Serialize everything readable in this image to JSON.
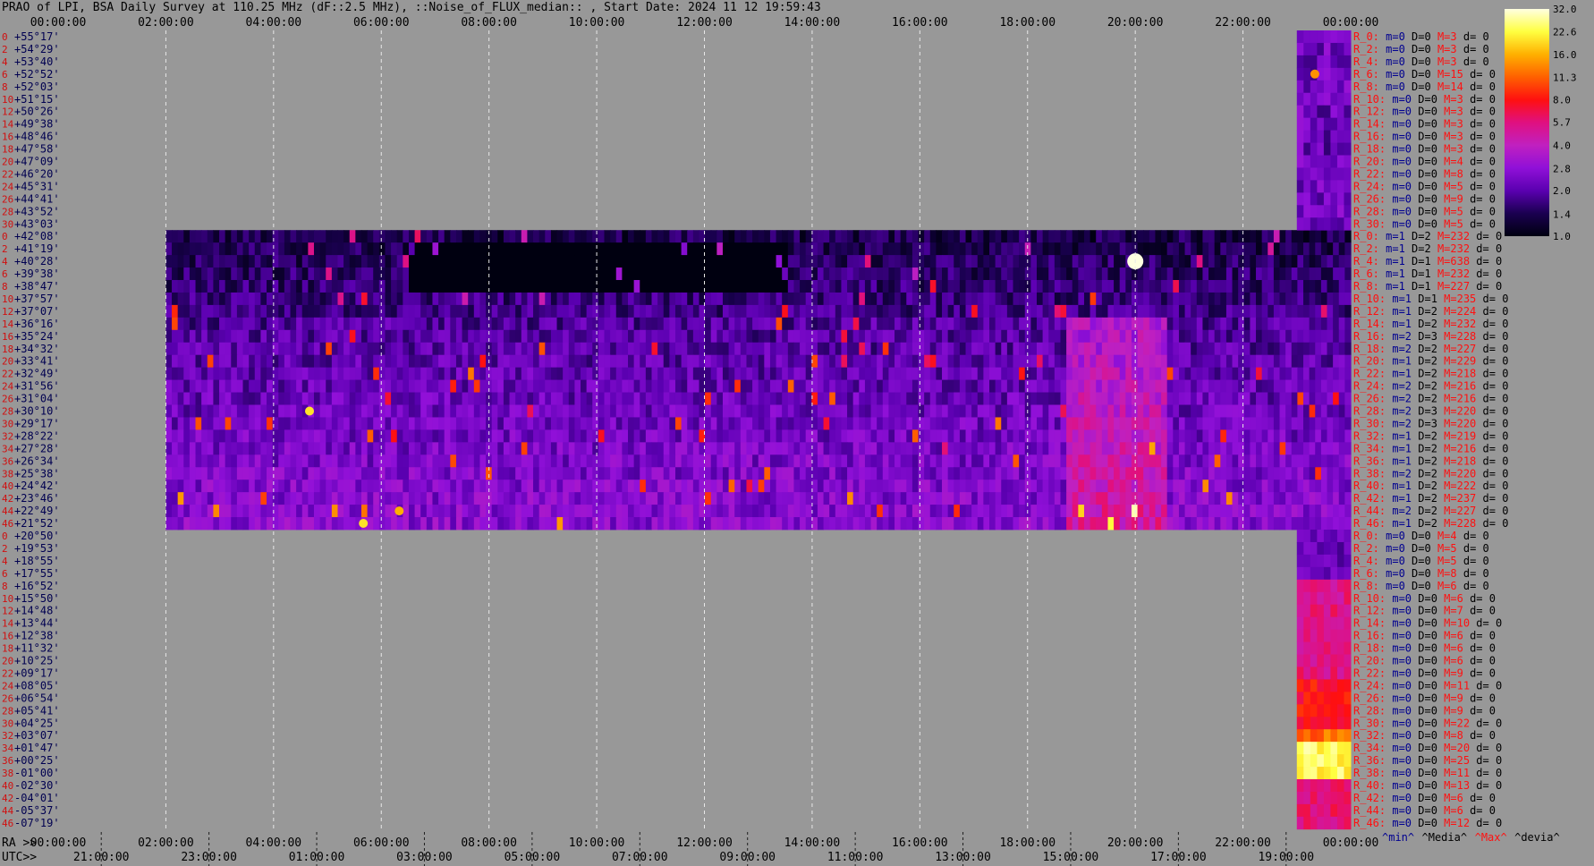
{
  "title": "PRAO of LPI, BSA Daily Survey at 110.25 MHz (dF::2.5 MHz), ::Noise_of_FLUX_median:: , Start Date: 2024 11 12 19:59:43",
  "top_time_labels": [
    "00:00:00",
    "02:00:00",
    "04:00:00",
    "06:00:00",
    "08:00:00",
    "10:00:00",
    "12:00:00",
    "14:00:00",
    "16:00:00",
    "18:00:00",
    "20:00:00",
    "22:00:00",
    "00:00:00"
  ],
  "bottom_axis": {
    "ra_prefix": "RA >>",
    "utc_prefix": "UTC>>",
    "ra_labels": [
      "00:00:00",
      "02:00:00",
      "04:00:00",
      "06:00:00",
      "08:00:00",
      "10:00:00",
      "12:00:00",
      "14:00:00",
      "16:00:00",
      "18:00:00",
      "20:00:00",
      "22:00:00",
      "00:00:00"
    ],
    "utc_labels": [
      "21:00:00",
      "23:00:00",
      "01:00:00",
      "03:00:00",
      "05:00:00",
      "07:00:00",
      "09:00:00",
      "11:00:00",
      "13:00:00",
      "15:00:00",
      "17:00:00",
      "19:00:00"
    ]
  },
  "row_indices": [
    "0",
    "2",
    "4",
    "6",
    "8",
    "10",
    "12",
    "14",
    "16",
    "18",
    "20",
    "22",
    "24",
    "26",
    "28",
    "30",
    "0",
    "2",
    "4",
    "6",
    "8",
    "10",
    "12",
    "14",
    "16",
    "18",
    "20",
    "22",
    "24",
    "26",
    "28",
    "30",
    "32",
    "34",
    "36",
    "38",
    "40",
    "42",
    "44",
    "46",
    "0",
    "2",
    "4",
    "6",
    "8",
    "10",
    "12",
    "14",
    "16",
    "18",
    "20",
    "22",
    "24",
    "26",
    "28",
    "30",
    "32",
    "34",
    "36",
    "38",
    "40",
    "42",
    "44",
    "46"
  ],
  "declinations": [
    "+55°17'",
    "+54°29'",
    "+53°40'",
    "+52°52'",
    "+52°03'",
    "+51°15'",
    "+50°26'",
    "+49°38'",
    "+48°46'",
    "+47°58'",
    "+47°09'",
    "+46°20'",
    "+45°31'",
    "+44°41'",
    "+43°52'",
    "+43°03'",
    "+42°08'",
    "+41°19'",
    "+40°28'",
    "+39°38'",
    "+38°47'",
    "+37°57'",
    "+37°07'",
    "+36°16'",
    "+35°24'",
    "+34°32'",
    "+33°41'",
    "+32°49'",
    "+31°56'",
    "+31°04'",
    "+30°10'",
    "+29°17'",
    "+28°22'",
    "+27°28'",
    "+26°34'",
    "+25°38'",
    "+24°42'",
    "+23°46'",
    "+22°49'",
    "+21°52'",
    "+20°50'",
    "+19°53'",
    "+18°55'",
    "+17°55'",
    "+16°52'",
    "+15°50'",
    "+14°48'",
    "+13°44'",
    "+12°38'",
    "+11°32'",
    "+10°25'",
    "+09°17'",
    "+08°05'",
    "+06°54'",
    "+05°41'",
    "+04°25'",
    "+03°07'",
    "+01°47'",
    "+00°25'",
    "-01°00'",
    "-02°30'",
    "-04°01'",
    "-05°37'",
    "-07°19'"
  ],
  "stats": [
    {
      "label": "R_0:",
      "m": "m=0",
      "d": "D=0",
      "M": "M=3",
      "dv": "d= 0"
    },
    {
      "label": "R_2:",
      "m": "m=0",
      "d": "D=0",
      "M": "M=3",
      "dv": "d= 0"
    },
    {
      "label": "R_4:",
      "m": "m=0",
      "d": "D=0",
      "M": "M=3",
      "dv": "d= 0"
    },
    {
      "label": "R_6:",
      "m": "m=0",
      "d": "D=0",
      "M": "M=15",
      "dv": "d= 0"
    },
    {
      "label": "R_8:",
      "m": "m=0",
      "d": "D=0",
      "M": "M=14",
      "dv": "d= 0"
    },
    {
      "label": "R_10:",
      "m": "m=0",
      "d": "D=0",
      "M": "M=3",
      "dv": "d= 0"
    },
    {
      "label": "R_12:",
      "m": "m=0",
      "d": "D=0",
      "M": "M=3",
      "dv": "d= 0"
    },
    {
      "label": "R_14:",
      "m": "m=0",
      "d": "D=0",
      "M": "M=3",
      "dv": "d= 0"
    },
    {
      "label": "R_16:",
      "m": "m=0",
      "d": "D=0",
      "M": "M=3",
      "dv": "d= 0"
    },
    {
      "label": "R_18:",
      "m": "m=0",
      "d": "D=0",
      "M": "M=3",
      "dv": "d= 0"
    },
    {
      "label": "R_20:",
      "m": "m=0",
      "d": "D=0",
      "M": "M=4",
      "dv": "d= 0"
    },
    {
      "label": "R_22:",
      "m": "m=0",
      "d": "D=0",
      "M": "M=8",
      "dv": "d= 0"
    },
    {
      "label": "R_24:",
      "m": "m=0",
      "d": "D=0",
      "M": "M=5",
      "dv": "d= 0"
    },
    {
      "label": "R_26:",
      "m": "m=0",
      "d": "D=0",
      "M": "M=9",
      "dv": "d= 0"
    },
    {
      "label": "R_28:",
      "m": "m=0",
      "d": "D=0",
      "M": "M=5",
      "dv": "d= 0"
    },
    {
      "label": "R_30:",
      "m": "m=0",
      "d": "D=0",
      "M": "M=5",
      "dv": "d= 0"
    },
    {
      "label": "R_0:",
      "m": "m=1",
      "d": "D=2",
      "M": "M=232",
      "dv": "d= 0"
    },
    {
      "label": "R_2:",
      "m": "m=1",
      "d": "D=2",
      "M": "M=232",
      "dv": "d= 0"
    },
    {
      "label": "R_4:",
      "m": "m=1",
      "d": "D=1",
      "M": "M=638",
      "dv": "d= 0"
    },
    {
      "label": "R_6:",
      "m": "m=1",
      "d": "D=1",
      "M": "M=232",
      "dv": "d= 0"
    },
    {
      "label": "R_8:",
      "m": "m=1",
      "d": "D=1",
      "M": "M=227",
      "dv": "d= 0"
    },
    {
      "label": "R_10:",
      "m": "m=1",
      "d": "D=1",
      "M": "M=235",
      "dv": "d= 0"
    },
    {
      "label": "R_12:",
      "m": "m=1",
      "d": "D=2",
      "M": "M=224",
      "dv": "d= 0"
    },
    {
      "label": "R_14:",
      "m": "m=1",
      "d": "D=2",
      "M": "M=232",
      "dv": "d= 0"
    },
    {
      "label": "R_16:",
      "m": "m=2",
      "d": "D=3",
      "M": "M=228",
      "dv": "d= 0"
    },
    {
      "label": "R_18:",
      "m": "m=2",
      "d": "D=2",
      "M": "M=227",
      "dv": "d= 0"
    },
    {
      "label": "R_20:",
      "m": "m=1",
      "d": "D=2",
      "M": "M=229",
      "dv": "d= 0"
    },
    {
      "label": "R_22:",
      "m": "m=1",
      "d": "D=2",
      "M": "M=218",
      "dv": "d= 0"
    },
    {
      "label": "R_24:",
      "m": "m=2",
      "d": "D=2",
      "M": "M=216",
      "dv": "d= 0"
    },
    {
      "label": "R_26:",
      "m": "m=2",
      "d": "D=2",
      "M": "M=216",
      "dv": "d= 0"
    },
    {
      "label": "R_28:",
      "m": "m=2",
      "d": "D=3",
      "M": "M=220",
      "dv": "d= 0"
    },
    {
      "label": "R_30:",
      "m": "m=2",
      "d": "D=3",
      "M": "M=220",
      "dv": "d= 0"
    },
    {
      "label": "R_32:",
      "m": "m=1",
      "d": "D=2",
      "M": "M=219",
      "dv": "d= 0"
    },
    {
      "label": "R_34:",
      "m": "m=1",
      "d": "D=2",
      "M": "M=216",
      "dv": "d= 0"
    },
    {
      "label": "R_36:",
      "m": "m=1",
      "d": "D=2",
      "M": "M=218",
      "dv": "d= 0"
    },
    {
      "label": "R_38:",
      "m": "m=2",
      "d": "D=2",
      "M": "M=220",
      "dv": "d= 0"
    },
    {
      "label": "R_40:",
      "m": "m=1",
      "d": "D=2",
      "M": "M=222",
      "dv": "d= 0"
    },
    {
      "label": "R_42:",
      "m": "m=1",
      "d": "D=2",
      "M": "M=237",
      "dv": "d= 0"
    },
    {
      "label": "R_44:",
      "m": "m=2",
      "d": "D=2",
      "M": "M=227",
      "dv": "d= 0"
    },
    {
      "label": "R_46:",
      "m": "m=1",
      "d": "D=2",
      "M": "M=228",
      "dv": "d= 0"
    },
    {
      "label": "R_0:",
      "m": "m=0",
      "d": "D=0",
      "M": "M=4",
      "dv": "d= 0"
    },
    {
      "label": "R_2:",
      "m": "m=0",
      "d": "D=0",
      "M": "M=5",
      "dv": "d= 0"
    },
    {
      "label": "R_4:",
      "m": "m=0",
      "d": "D=0",
      "M": "M=5",
      "dv": "d= 0"
    },
    {
      "label": "R_6:",
      "m": "m=0",
      "d": "D=0",
      "M": "M=8",
      "dv": "d= 0"
    },
    {
      "label": "R_8:",
      "m": "m=0",
      "d": "D=0",
      "M": "M=6",
      "dv": "d= 0"
    },
    {
      "label": "R_10:",
      "m": "m=0",
      "d": "D=0",
      "M": "M=6",
      "dv": "d= 0"
    },
    {
      "label": "R_12:",
      "m": "m=0",
      "d": "D=0",
      "M": "M=7",
      "dv": "d= 0"
    },
    {
      "label": "R_14:",
      "m": "m=0",
      "d": "D=0",
      "M": "M=10",
      "dv": "d= 0"
    },
    {
      "label": "R_16:",
      "m": "m=0",
      "d": "D=0",
      "M": "M=6",
      "dv": "d= 0"
    },
    {
      "label": "R_18:",
      "m": "m=0",
      "d": "D=0",
      "M": "M=6",
      "dv": "d= 0"
    },
    {
      "label": "R_20:",
      "m": "m=0",
      "d": "D=0",
      "M": "M=6",
      "dv": "d= 0"
    },
    {
      "label": "R_22:",
      "m": "m=0",
      "d": "D=0",
      "M": "M=9",
      "dv": "d= 0"
    },
    {
      "label": "R_24:",
      "m": "m=0",
      "d": "D=0",
      "M": "M=11",
      "dv": "d= 0"
    },
    {
      "label": "R_26:",
      "m": "m=0",
      "d": "D=0",
      "M": "M=9",
      "dv": "d= 0"
    },
    {
      "label": "R_28:",
      "m": "m=0",
      "d": "D=0",
      "M": "M=9",
      "dv": "d= 0"
    },
    {
      "label": "R_30:",
      "m": "m=0",
      "d": "D=0",
      "M": "M=22",
      "dv": "d= 0"
    },
    {
      "label": "R_32:",
      "m": "m=0",
      "d": "D=0",
      "M": "M=8",
      "dv": "d= 0"
    },
    {
      "label": "R_34:",
      "m": "m=0",
      "d": "D=0",
      "M": "M=20",
      "dv": "d= 0"
    },
    {
      "label": "R_36:",
      "m": "m=0",
      "d": "D=0",
      "M": "M=25",
      "dv": "d= 0"
    },
    {
      "label": "R_38:",
      "m": "m=0",
      "d": "D=0",
      "M": "M=11",
      "dv": "d= 0"
    },
    {
      "label": "R_40:",
      "m": "m=0",
      "d": "D=0",
      "M": "M=13",
      "dv": "d= 0"
    },
    {
      "label": "R_42:",
      "m": "m=0",
      "d": "D=0",
      "M": "M=6",
      "dv": "d= 0"
    },
    {
      "label": "R_44:",
      "m": "m=0",
      "d": "D=0",
      "M": "M=6",
      "dv": "d= 0"
    },
    {
      "label": "R_46:",
      "m": "m=0",
      "d": "D=0",
      "M": "M=12",
      "dv": "d= 0"
    }
  ],
  "legend_footer": [
    "^min^",
    "^Media^",
    "^Max^",
    "^devia^"
  ],
  "colors": {
    "background": "#989898",
    "index_text": "#d01010",
    "dec_text": "#000050",
    "stat_label": "#ff1010",
    "stat_min": "#000090",
    "stat_max": "#ff1010",
    "stat_dev": "#000000",
    "colormap": [
      "#000010",
      "#1a0050",
      "#5a00b0",
      "#9010d8",
      "#c020c0",
      "#e01080",
      "#ff1010",
      "#ff6000",
      "#ffb000",
      "#ffff40",
      "#ffffe0"
    ]
  },
  "chart_data": {
    "type": "heatmap",
    "title": "PRAO of LPI, BSA Daily Survey at 110.25 MHz (dF::2.5 MHz), ::Noise_of_FLUX_median:: , Start Date: 2024 11 12 19:59:43",
    "colorbar": {
      "ticks": [
        32.0,
        22.6,
        16.0,
        11.3,
        8.0,
        5.7,
        4.0,
        2.8,
        2.0,
        1.4,
        1.0
      ],
      "scale": "log"
    },
    "blocks": [
      {
        "rows": "0-30 (16 beams)",
        "dec_range": [
          "+55°17'",
          "+43°03'"
        ],
        "ra_coverage": [
          "23:00:00",
          "00:00:00"
        ],
        "typical_level": 2.0,
        "max_level": 15
      },
      {
        "rows": "0-46 (24 beams)",
        "dec_range": [
          "+42°08'",
          "+21°52'"
        ],
        "ra_coverage": [
          "02:00:00",
          "24:00:00"
        ],
        "typical_level": 2.4,
        "max_level": 638
      },
      {
        "rows": "0-46 (24 beams)",
        "dec_range": [
          "+20°50'",
          "-07°19'"
        ],
        "ra_coverage": [
          "23:00:00",
          "00:00:00"
        ],
        "typical_level": 5.0,
        "max_level": 25
      }
    ],
    "hotspots": [
      {
        "ra": "20:00:00",
        "dec": "+40°28'",
        "level": 32
      },
      {
        "ra": "04:40:00",
        "dec": "+30°10'",
        "level": 20
      },
      {
        "ra": "05:40:00",
        "dec": "+21°52'",
        "level": 20
      },
      {
        "ra": "06:20:00",
        "dec": "+22°49'",
        "level": 16
      },
      {
        "ra": "23:20:00",
        "dec": "+52°52'",
        "level": 14
      }
    ]
  }
}
